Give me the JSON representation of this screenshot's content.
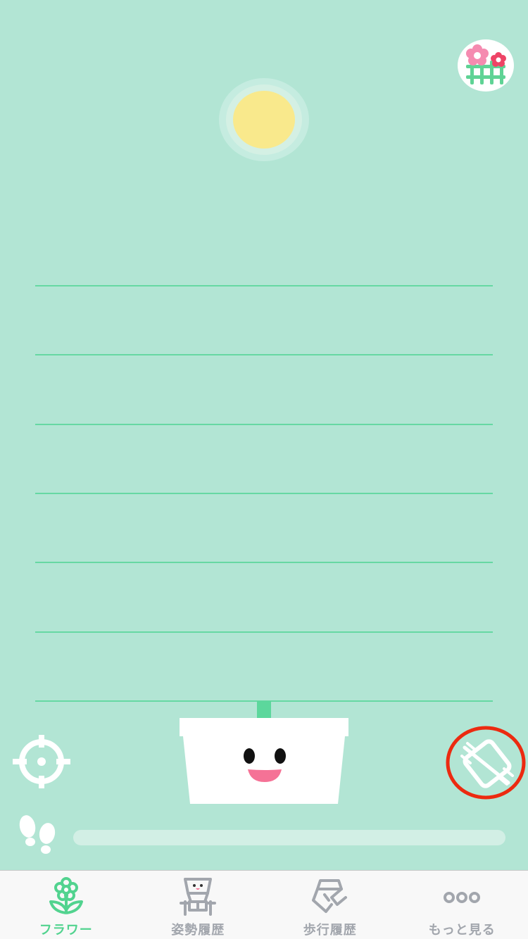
{
  "colors": {
    "background": "#b2e5d4",
    "accent": "#52d38f",
    "guide_line": "#66d8a3",
    "sun": "#f9e98c",
    "highlight": "#ec2a10",
    "tab_inactive": "#a2a6ad"
  },
  "garden_button": {
    "icon": "flower-garden-icon"
  },
  "sun": {
    "icon": "sun-icon"
  },
  "guide_lines_count": 7,
  "pot": {
    "icon": "smiling-flower-pot-icon"
  },
  "controls": {
    "locate_icon": "crosshair-icon",
    "rotate_icon": "screen-rotation-lock-icon"
  },
  "steps": {
    "icon": "footprints-icon",
    "progress": 0
  },
  "tabs": [
    {
      "label": "フラワー",
      "icon": "flower-icon",
      "active": true
    },
    {
      "label": "姿勢履歴",
      "icon": "posture-history-icon",
      "active": false
    },
    {
      "label": "歩行履歴",
      "icon": "walking-history-icon",
      "active": false
    },
    {
      "label": "もっと見る",
      "icon": "more-dots-icon",
      "active": false
    }
  ]
}
